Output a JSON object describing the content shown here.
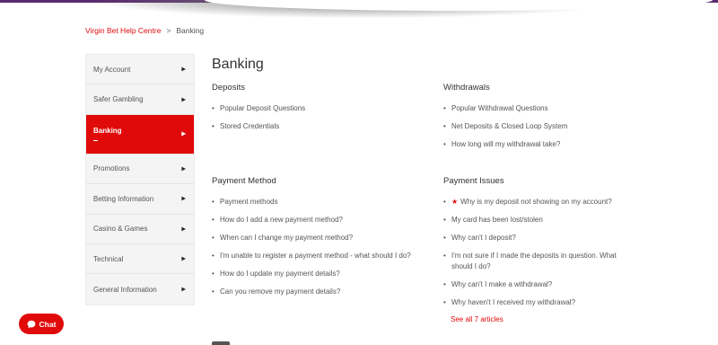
{
  "breadcrumb": {
    "home": "Virgin Bet Help Centre",
    "separator": ">",
    "current": "Banking"
  },
  "sidebar": {
    "items": [
      {
        "label": "My Account"
      },
      {
        "label": "Safer Gambling"
      },
      {
        "label": "Banking"
      },
      {
        "label": "Promotions"
      },
      {
        "label": "Betting Information"
      },
      {
        "label": "Casino & Games"
      },
      {
        "label": "Technical"
      },
      {
        "label": "General Information"
      }
    ],
    "active_index": 2
  },
  "page": {
    "title": "Banking"
  },
  "sections": {
    "deposits": {
      "title": "Deposits",
      "items": [
        "Popular Deposit Questions",
        "Stored Credentials"
      ]
    },
    "withdrawals": {
      "title": "Withdrawals",
      "items": [
        "Popular Withdrawal Questions",
        "Net Deposits & Closed Loop System",
        "How long will my withdrawal take?"
      ]
    },
    "payment_method": {
      "title": "Payment Method",
      "items": [
        "Payment methods",
        "How do I add a new payment method?",
        "When can I change my payment method?",
        "I'm unable to register a payment method - what should I do?",
        "How do I update my payment details?",
        "Can you remove my payment details?"
      ]
    },
    "payment_issues": {
      "title": "Payment Issues",
      "items": [
        "Why is my deposit not showing on my account?",
        "My card has been lost/stolen",
        "Why can't I deposit?",
        "I'm not sure if I made the deposits in question. What should I do?",
        "Why can't I make a withdrawal?",
        "Why haven't I received my withdrawal?"
      ],
      "see_all": "See all 7 articles"
    }
  },
  "chat": {
    "label": "Chat"
  },
  "icons": {
    "chevron": "chevron-right-icon",
    "star": "star-icon",
    "chat": "chat-bubble-icon"
  },
  "colors": {
    "accent": "#e10a0a",
    "topbar": "#5a2a6e"
  }
}
